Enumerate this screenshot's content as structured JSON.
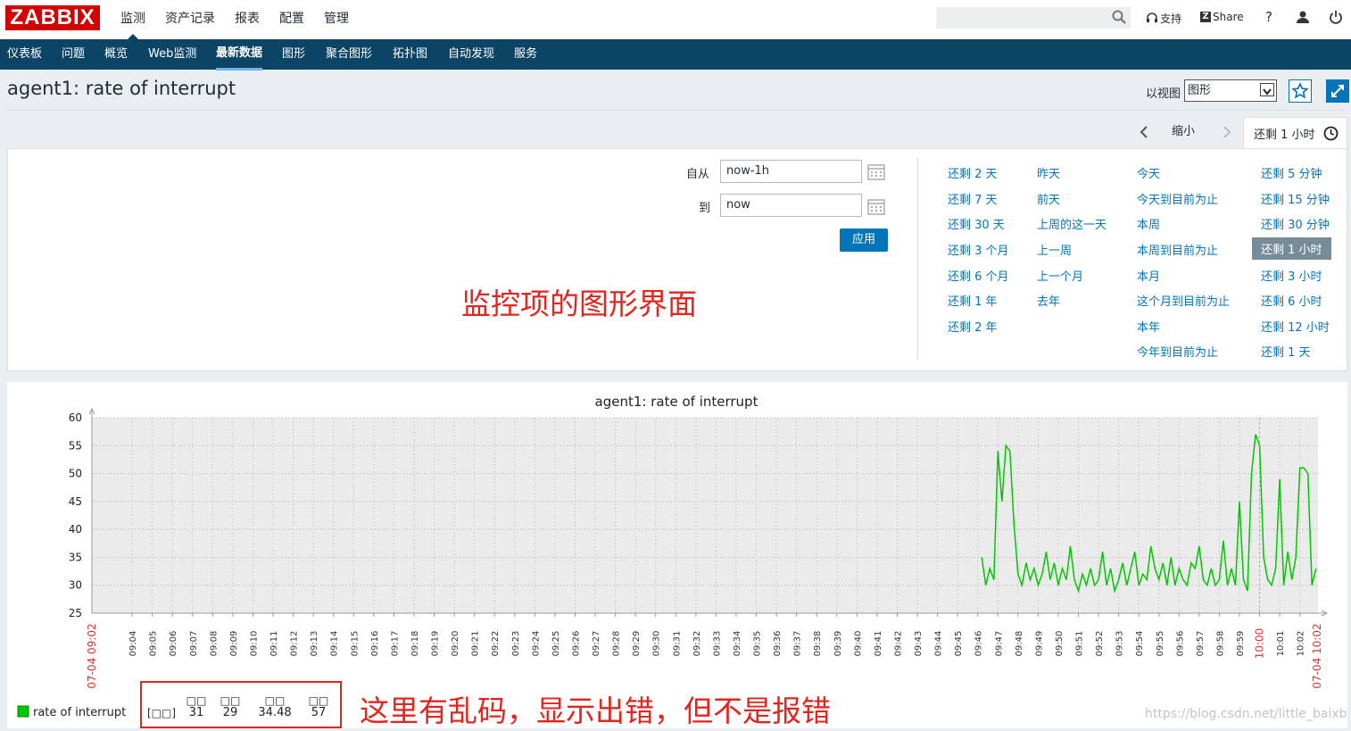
{
  "header": {
    "logo": "ZABBIX",
    "menu": [
      "监测",
      "资产记录",
      "报表",
      "配置",
      "管理"
    ],
    "support_label": "支持",
    "share_label": "Share",
    "help_label": "?"
  },
  "subnav": {
    "items": [
      "仪表板",
      "问题",
      "概览",
      "Web监测",
      "最新数据",
      "图形",
      "聚合图形",
      "拓扑图",
      "自动发现",
      "服务"
    ]
  },
  "page": {
    "title": "agent1: rate of interrupt",
    "view_as_label": "以视图",
    "view_as_value": "图形"
  },
  "timebar": {
    "zoom_out": "缩小",
    "current": "还剩 1 小时"
  },
  "filter": {
    "from_label": "自从",
    "from_value": "now-1h",
    "to_label": "到",
    "to_value": "now",
    "apply_label": "应用",
    "quick": [
      [
        "还剩 2 天",
        "还剩 7 天",
        "还剩 30 天",
        "还剩 3 个月",
        "还剩 6 个月",
        "还剩 1 年",
        "还剩 2 年"
      ],
      [
        "昨天",
        "前天",
        "上周的这一天",
        "上一周",
        "上一个月",
        "去年"
      ],
      [
        "今天",
        "今天到目前为止",
        "本周",
        "本周到目前为止",
        "本月",
        "这个月到目前为止",
        "本年",
        "今年到目前为止"
      ],
      [
        "还剩 5 分钟",
        "还剩 15 分钟",
        "还剩 30 分钟",
        "还剩 1 小时",
        "还剩 3 小时",
        "还剩 6 小时",
        "还剩 12 小时",
        "还剩 1 天"
      ]
    ],
    "quick_selected": "还剩 1 小时"
  },
  "annotations": {
    "top": "监控项的图形界面",
    "bottom": "这里有乱码，显示出错，但不是报错"
  },
  "watermark": "https://blog.csdn.net/little_baixb",
  "colors": {
    "logo": "#d40000",
    "nav": "#0b4465",
    "link": "#0275b8",
    "series": "#00c800",
    "annotation": "#e4241d"
  },
  "chart_data": {
    "type": "line",
    "title": "agent1: rate of interrupt",
    "xlabel": "",
    "ylabel": "",
    "ylim": [
      25,
      60
    ],
    "yticks": [
      25,
      30,
      35,
      40,
      45,
      50,
      55,
      60
    ],
    "x_start_label": "07-04 09:02",
    "x_end_label": "07-04 10:02",
    "x_tick_labels": [
      "09:04",
      "09:05",
      "09:06",
      "09:07",
      "09:08",
      "09:09",
      "09:10",
      "09:11",
      "09:12",
      "09:13",
      "09:14",
      "09:15",
      "09:16",
      "09:17",
      "09:18",
      "09:19",
      "09:20",
      "09:21",
      "09:22",
      "09:23",
      "09:24",
      "09:25",
      "09:26",
      "09:27",
      "09:28",
      "09:29",
      "09:30",
      "09:31",
      "09:32",
      "09:33",
      "09:34",
      "09:35",
      "09:36",
      "09:37",
      "09:38",
      "09:39",
      "09:40",
      "09:41",
      "09:42",
      "09:43",
      "09:44",
      "09:45",
      "09:46",
      "09:47",
      "09:48",
      "09:49",
      "09:50",
      "09:51",
      "09:52",
      "09:53",
      "09:54",
      "09:55",
      "09:56",
      "09:57",
      "09:58",
      "09:59",
      "10:00",
      "10:01",
      "10:02"
    ],
    "x_highlight": "10:00",
    "grid": true,
    "legend_placement": "bottom-left",
    "series": [
      {
        "name": "rate of interrupt",
        "color": "#00c800",
        "points": [
          [
            46.2,
            35
          ],
          [
            46.4,
            30
          ],
          [
            46.6,
            33
          ],
          [
            46.8,
            31
          ],
          [
            47.0,
            54
          ],
          [
            47.2,
            45
          ],
          [
            47.4,
            55
          ],
          [
            47.6,
            54
          ],
          [
            47.8,
            41
          ],
          [
            48.0,
            32
          ],
          [
            48.2,
            30
          ],
          [
            48.4,
            34
          ],
          [
            48.6,
            31
          ],
          [
            48.8,
            33
          ],
          [
            49.0,
            30
          ],
          [
            49.2,
            32
          ],
          [
            49.4,
            36
          ],
          [
            49.6,
            31
          ],
          [
            49.8,
            34
          ],
          [
            50.0,
            30
          ],
          [
            50.2,
            33
          ],
          [
            50.4,
            31
          ],
          [
            50.6,
            37
          ],
          [
            50.8,
            31
          ],
          [
            51.0,
            29
          ],
          [
            51.2,
            32
          ],
          [
            51.4,
            30
          ],
          [
            51.6,
            33
          ],
          [
            51.8,
            30
          ],
          [
            52.0,
            31
          ],
          [
            52.2,
            36
          ],
          [
            52.4,
            30
          ],
          [
            52.6,
            33
          ],
          [
            52.8,
            29
          ],
          [
            53.0,
            31
          ],
          [
            53.2,
            34
          ],
          [
            53.4,
            30
          ],
          [
            53.6,
            33
          ],
          [
            53.8,
            36
          ],
          [
            54.0,
            30
          ],
          [
            54.2,
            32
          ],
          [
            54.4,
            31
          ],
          [
            54.6,
            37
          ],
          [
            54.8,
            33
          ],
          [
            55.0,
            31
          ],
          [
            55.2,
            34
          ],
          [
            55.4,
            30
          ],
          [
            55.6,
            35
          ],
          [
            55.8,
            30
          ],
          [
            56.0,
            33
          ],
          [
            56.2,
            31
          ],
          [
            56.4,
            30
          ],
          [
            56.6,
            34
          ],
          [
            56.8,
            33
          ],
          [
            57.0,
            37
          ],
          [
            57.2,
            31
          ],
          [
            57.4,
            30
          ],
          [
            57.6,
            33
          ],
          [
            57.8,
            30
          ],
          [
            58.0,
            31
          ],
          [
            58.2,
            38
          ],
          [
            58.4,
            30
          ],
          [
            58.6,
            33
          ],
          [
            58.8,
            30
          ],
          [
            59.0,
            45
          ],
          [
            59.2,
            31
          ],
          [
            59.4,
            29
          ],
          [
            59.6,
            50
          ],
          [
            59.8,
            57
          ],
          [
            60.0,
            55
          ],
          [
            60.2,
            35
          ],
          [
            60.4,
            31
          ],
          [
            60.6,
            30
          ],
          [
            60.8,
            33
          ],
          [
            61.0,
            49
          ],
          [
            61.2,
            30
          ],
          [
            61.4,
            36
          ],
          [
            61.6,
            31
          ],
          [
            61.8,
            35
          ],
          [
            62.0,
            51
          ],
          [
            62.2,
            51
          ],
          [
            62.4,
            50
          ],
          [
            62.6,
            30
          ],
          [
            62.8,
            33
          ]
        ]
      }
    ],
    "legend_stats": {
      "label": "[□□]",
      "headers": [
        "□□",
        "□□",
        "□□",
        "□□"
      ],
      "values": [
        "31",
        "29",
        "34.48",
        "57"
      ]
    }
  }
}
